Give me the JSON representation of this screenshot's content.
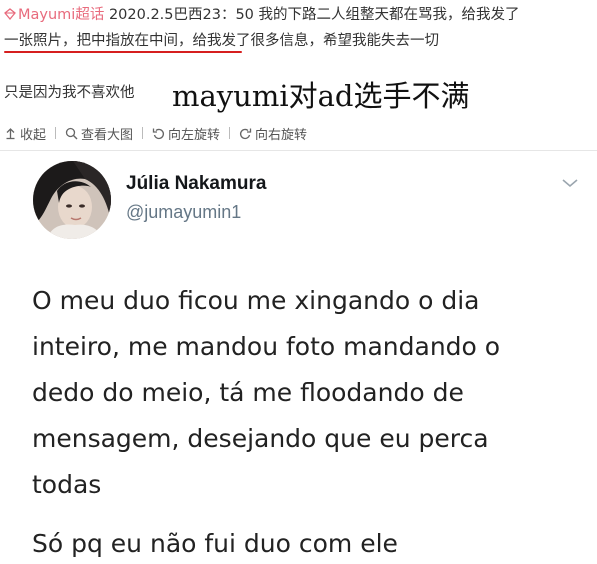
{
  "post": {
    "tag": "Mayumi超话",
    "line1_rest": "2020.2.5巴西23：50 我的下路二人组整天都在骂我，给我发了",
    "line2_underlined": "一张照片，把中指放在中间，",
    "line2_rest": "给我发了很多信息，希望我能失去一切",
    "line3": "只是因为我不喜欢他",
    "tag_color": "#e86b7d",
    "underline_color": "#d61f1f"
  },
  "caption": {
    "text": "mayumi对ad选手不满"
  },
  "toolbar": {
    "collapse_label": "收起",
    "view_large_label": "查看大图",
    "rotate_left_label": "向左旋转",
    "rotate_right_label": "向右旋转"
  },
  "tweet": {
    "display_name": "Júlia Nakamura",
    "handle": "@jumayumin1",
    "lines": [
      "O meu duo ficou me xingando o dia",
      "inteiro, me mandou foto mandando o",
      "dedo do meio, tá me floodando de",
      "mensagem, desejando que eu perca",
      "todas"
    ],
    "reply_line": "Só pq eu não fui duo com ele",
    "name_color": "#14171a",
    "handle_color": "#657786"
  },
  "icons": {
    "tag": "diamond-tag-icon",
    "collapse": "arrow-up-icon",
    "view_large": "magnifier-icon",
    "rotate_left": "rotate-left-icon",
    "rotate_right": "rotate-right-icon",
    "tweet_menu": "chevron-down-icon"
  }
}
